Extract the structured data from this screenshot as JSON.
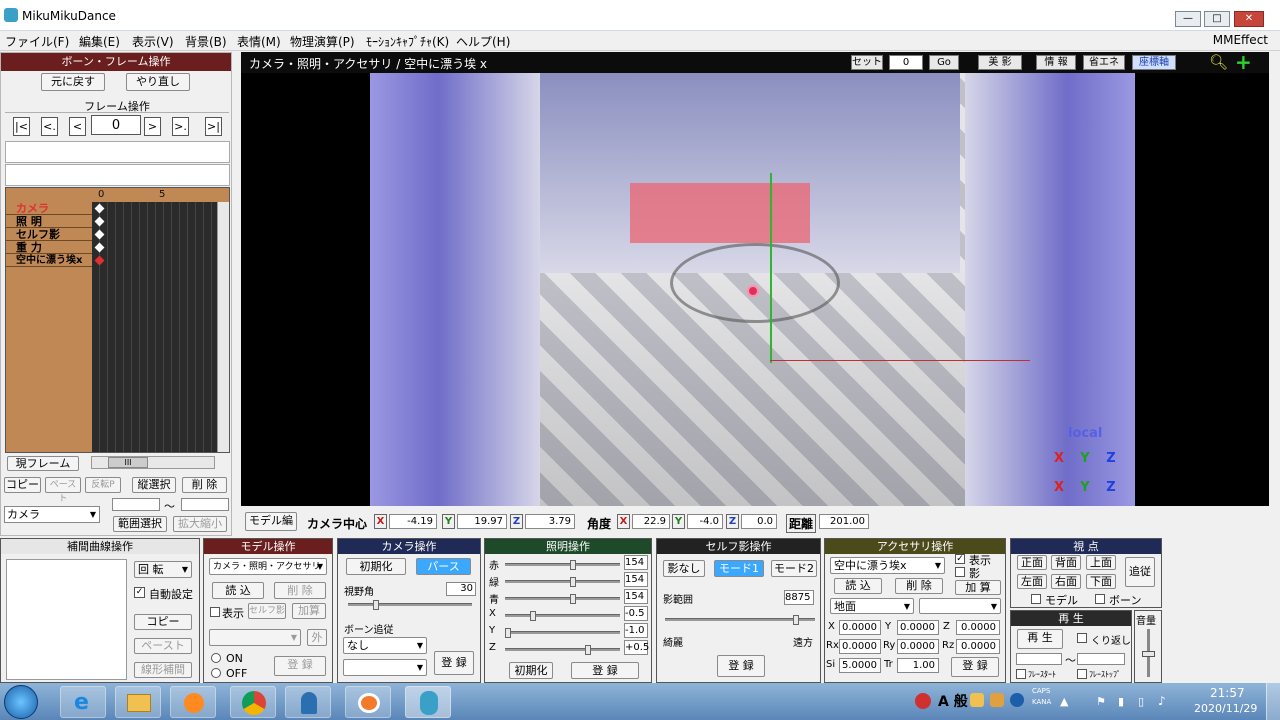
{
  "window": {
    "title": "MikuMikuDance",
    "min": "—",
    "max": "□",
    "close": "✕"
  },
  "menu": [
    "ファイル(F)",
    "編集(E)",
    "表示(V)",
    "背景(B)",
    "表情(M)",
    "物理演算(P)",
    "ﾓｰｼｮﾝｷｬﾌﾟﾁｬ(K)",
    "ヘルプ(H)"
  ],
  "menu_right": "MMEffect",
  "left": {
    "bone_header": "ボーン・フレーム操作",
    "undo": "元に戻す",
    "redo": "やり直し",
    "frame_header": "フレーム操作",
    "nav": [
      "|<",
      "<.",
      "<",
      ">",
      ">.",
      ">|"
    ],
    "frame_value": "0",
    "ruler": [
      "0",
      "5"
    ],
    "tracks": [
      "カメラ",
      "照 明",
      "セルフ影",
      "重 力",
      "空中に漂う埃x"
    ],
    "current_frame": "現フレーム",
    "copy": "コピー",
    "paste": "ペースト",
    "reverse": "反転P",
    "vselect": "縦選択",
    "delete": "削 除",
    "range_target": "カメラ",
    "tilde": "～",
    "range_select": "範囲選択",
    "zoom": "拡大縮小",
    "scroll_thumb": "III"
  },
  "viewport": {
    "title": "カメラ・照明・アクセサリ / 空中に漂う埃",
    "title_close": "x",
    "set": "セット",
    "set_value": "0",
    "go": "Go",
    "buttons": [
      "美 影",
      "情 報",
      "省エネ",
      "座標軸"
    ],
    "local": "local",
    "axes": [
      "X",
      "Y",
      "Z"
    ]
  },
  "camera_bar": {
    "model_edit": "モデル編",
    "center_label": "カメラ中心",
    "x_label": "X",
    "x": "-4.19",
    "y_label": "Y",
    "y": "19.97",
    "z_label": "Z",
    "z": "3.79",
    "angle_label": "角度",
    "ax": "22.9",
    "ay": "-4.0",
    "az": "0.0",
    "dist_label": "距離",
    "dist": "201.00"
  },
  "panels": {
    "interp": {
      "title": "補間曲線操作",
      "rot": "回 転",
      "auto": "自動設定",
      "copy": "コピー",
      "paste": "ペースト",
      "linear": "線形補間"
    },
    "model": {
      "title": "モデル操作",
      "select": "カメラ・照明・アクセサリ",
      "load": "読 込",
      "delete": "削 除",
      "show": "表示",
      "self_shadow": "セルフ影",
      "add": "加算",
      "outer": "外",
      "on": "ON",
      "off": "OFF",
      "register": "登 録"
    },
    "camera": {
      "title": "カメラ操作",
      "init": "初期化",
      "perspective": "パース",
      "fov_label": "視野角",
      "fov": "30",
      "bone_follow": "ボーン追従",
      "none": "なし",
      "register": "登 録"
    },
    "light": {
      "title": "照明操作",
      "r_label": "赤",
      "r": "154",
      "g_label": "緑",
      "g": "154",
      "b_label": "青",
      "b": "154",
      "x_label": "X",
      "x": "-0.5",
      "y_label": "Y",
      "y": "-1.0",
      "z_label": "Z",
      "z": "+0.5",
      "init": "初期化",
      "register": "登 録"
    },
    "shadow": {
      "title": "セルフ影操作",
      "none": "影なし",
      "mode1": "モード1",
      "mode2": "モード2",
      "range_label": "影範囲",
      "range": "8875",
      "near": "綺麗",
      "far": "遠方",
      "register": "登 録"
    },
    "accessory": {
      "title": "アクセサリ操作",
      "select": "空中に漂う埃x",
      "show": "表示",
      "shadow": "影",
      "load": "読 込",
      "delete": "削 除",
      "add": "加 算",
      "parent": "地面",
      "x_label": "X",
      "x": "0.0000",
      "y_label": "Y",
      "y": "0.0000",
      "z_label": "Z",
      "z": "0.0000",
      "rx_label": "Rx",
      "rx": "0.0000",
      "ry_label": "Ry",
      "ry": "0.0000",
      "rz_label": "Rz",
      "rz": "0.0000",
      "si_label": "Si",
      "si": "5.0000",
      "tr_label": "Tr",
      "tr": "1.00",
      "register": "登 録"
    },
    "view": {
      "title": "視 点",
      "front": "正面",
      "back": "背面",
      "top": "上面",
      "left": "左面",
      "right": "右面",
      "bottom": "下面",
      "follow": "追従",
      "model": "モデル",
      "bone": "ボーン"
    },
    "play": {
      "title": "再 生",
      "play": "再 生",
      "repeat": "くり返し",
      "start": "ﾌﾚｰｽﾀｰﾄ",
      "stop": "ﾌﾚｰｽﾄｯﾌﾟ",
      "tilde": "～",
      "volume": "音量"
    }
  },
  "taskbar": {
    "ime": "A 般",
    "caps": "CAPS",
    "kana": "KANA",
    "time": "21:57",
    "date": "2020/11/29"
  },
  "colors": {
    "red_header": "#6b1e1e",
    "camera_header": "#1f2a56",
    "light_header": "#1f4a2a",
    "shadow_header": "#222",
    "accessory_header": "#4a4a1a",
    "view_header": "#1f2a56",
    "play_header": "#2a2a2a"
  }
}
